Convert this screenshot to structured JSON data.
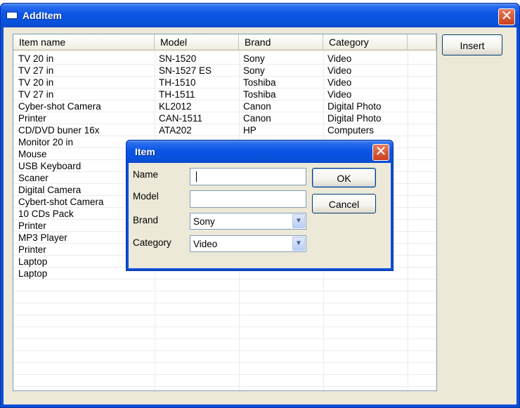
{
  "window": {
    "title": "AddItem",
    "close_label": "✕"
  },
  "list": {
    "headers": [
      "Item name",
      "Model",
      "Brand",
      "Category"
    ],
    "rows": [
      [
        "TV 20 in",
        "SN-1520",
        "Sony",
        "Video"
      ],
      [
        "TV 27 in",
        "SN-1527 ES",
        "Sony",
        "Video"
      ],
      [
        "TV 20 in",
        "TH-1510",
        "Toshiba",
        "Video"
      ],
      [
        "TV 27 in",
        "TH-1511",
        "Toshiba",
        "Video"
      ],
      [
        "Cyber-shot Camera",
        "KL2012",
        "Canon",
        "Digital Photo"
      ],
      [
        "Printer",
        "CAN-1511",
        "Canon",
        "Digital Photo"
      ],
      [
        "CD/DVD buner 16x",
        "ATA202",
        "HP",
        "Computers"
      ],
      [
        "Monitor 20 in",
        "",
        "",
        ""
      ],
      [
        "Mouse",
        "",
        "",
        ""
      ],
      [
        "USB Keyboard",
        "",
        "",
        ""
      ],
      [
        "Scaner",
        "",
        "",
        ""
      ],
      [
        "Digital Camera",
        "",
        "",
        ""
      ],
      [
        "Cybert-shot Camera",
        "",
        "",
        ""
      ],
      [
        "10 CDs Pack",
        "",
        "",
        ""
      ],
      [
        "Printer",
        "",
        "",
        ""
      ],
      [
        "MP3 Player",
        "",
        "",
        ""
      ],
      [
        "Printer",
        "",
        "",
        ""
      ],
      [
        "Laptop",
        "",
        "",
        ""
      ],
      [
        "Laptop",
        "",
        "",
        ""
      ]
    ]
  },
  "insert_button": {
    "label": "Insert"
  },
  "dialog": {
    "title": "Item",
    "close_label": "✕",
    "name": {
      "label": "Name",
      "value": ""
    },
    "model": {
      "label": "Model",
      "value": ""
    },
    "brand": {
      "label": "Brand",
      "value": "Sony"
    },
    "category": {
      "label": "Category",
      "value": "Video"
    },
    "ok_label": "OK",
    "cancel_label": "Cancel"
  },
  "colors": {
    "titlebar": "#0a55e3",
    "window_bg": "#ece9d8",
    "close_red": "#c9401c",
    "grid_line": "#ececec"
  },
  "icons": {
    "window": "window-icon",
    "close": "close-icon",
    "dropdown": "chevron-down-icon"
  }
}
